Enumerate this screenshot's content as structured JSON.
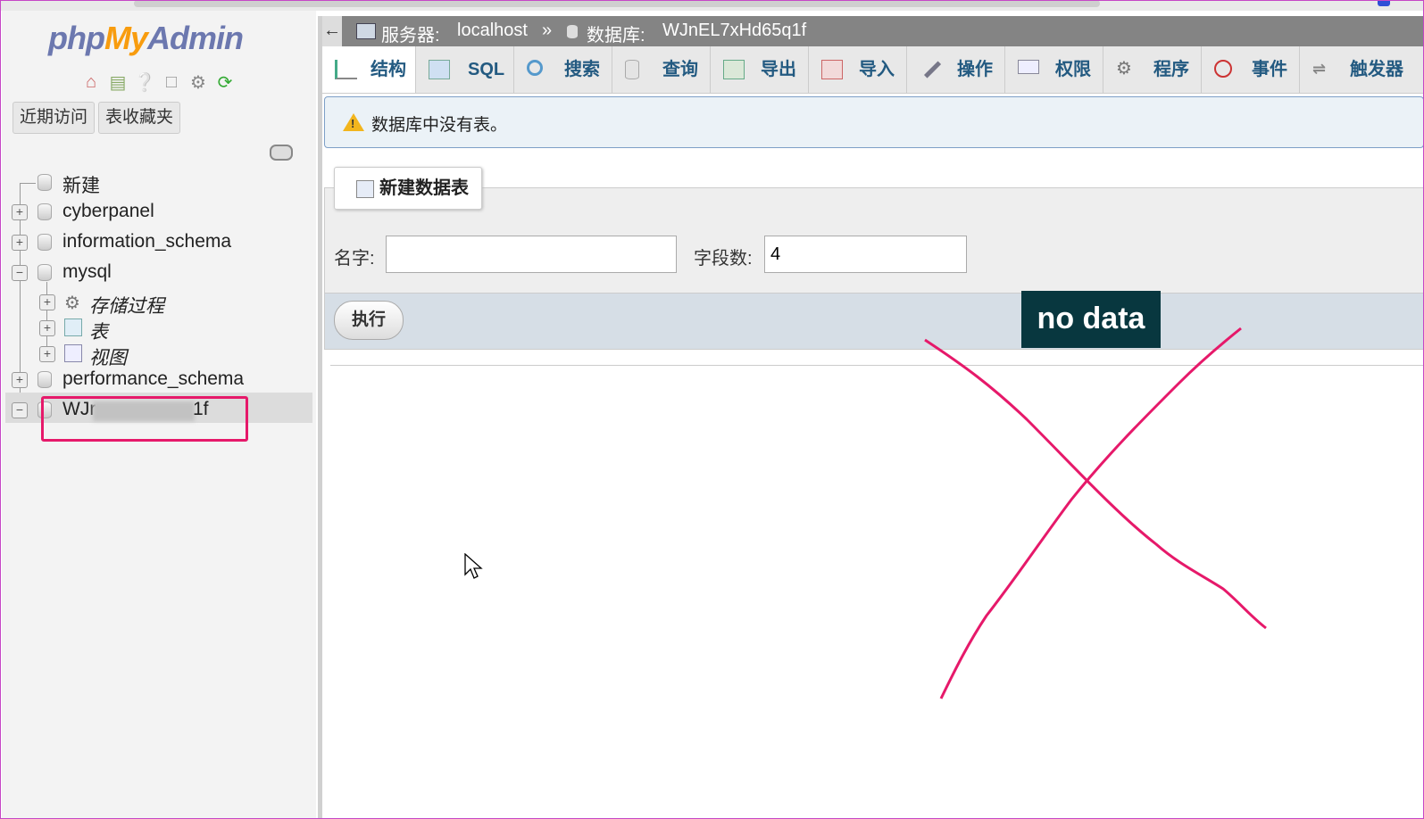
{
  "logo": {
    "php": "php",
    "my": "My",
    "admin": "Admin"
  },
  "sidebar": {
    "tabs": [
      "近期访问",
      "表收藏夹"
    ],
    "tree": {
      "new": "新建",
      "dbs": [
        "cyberpanel",
        "information_schema",
        "mysql",
        "performance_schema"
      ],
      "mysql_children": [
        "存储过程",
        "表",
        "视图"
      ],
      "selected_db_prefix": "WJr",
      "selected_db_suffix": "1f"
    }
  },
  "breadcrumb": {
    "back": "←",
    "server_label": "服务器:",
    "server": "localhost",
    "sep": "»",
    "db_label": "数据库:",
    "db": "WJnEL7xHd65q1f"
  },
  "tabs": [
    "结构",
    "SQL",
    "搜索",
    "查询",
    "导出",
    "导入",
    "操作",
    "权限",
    "程序",
    "事件",
    "触发器"
  ],
  "notice": "数据库中没有表。",
  "create_table": {
    "legend": "新建数据表",
    "name_label": "名字:",
    "name_value": "",
    "fields_label": "字段数:",
    "fields_value": "4",
    "go": "执行"
  },
  "annotation": {
    "label": "no data",
    "color": "#e6196a"
  }
}
